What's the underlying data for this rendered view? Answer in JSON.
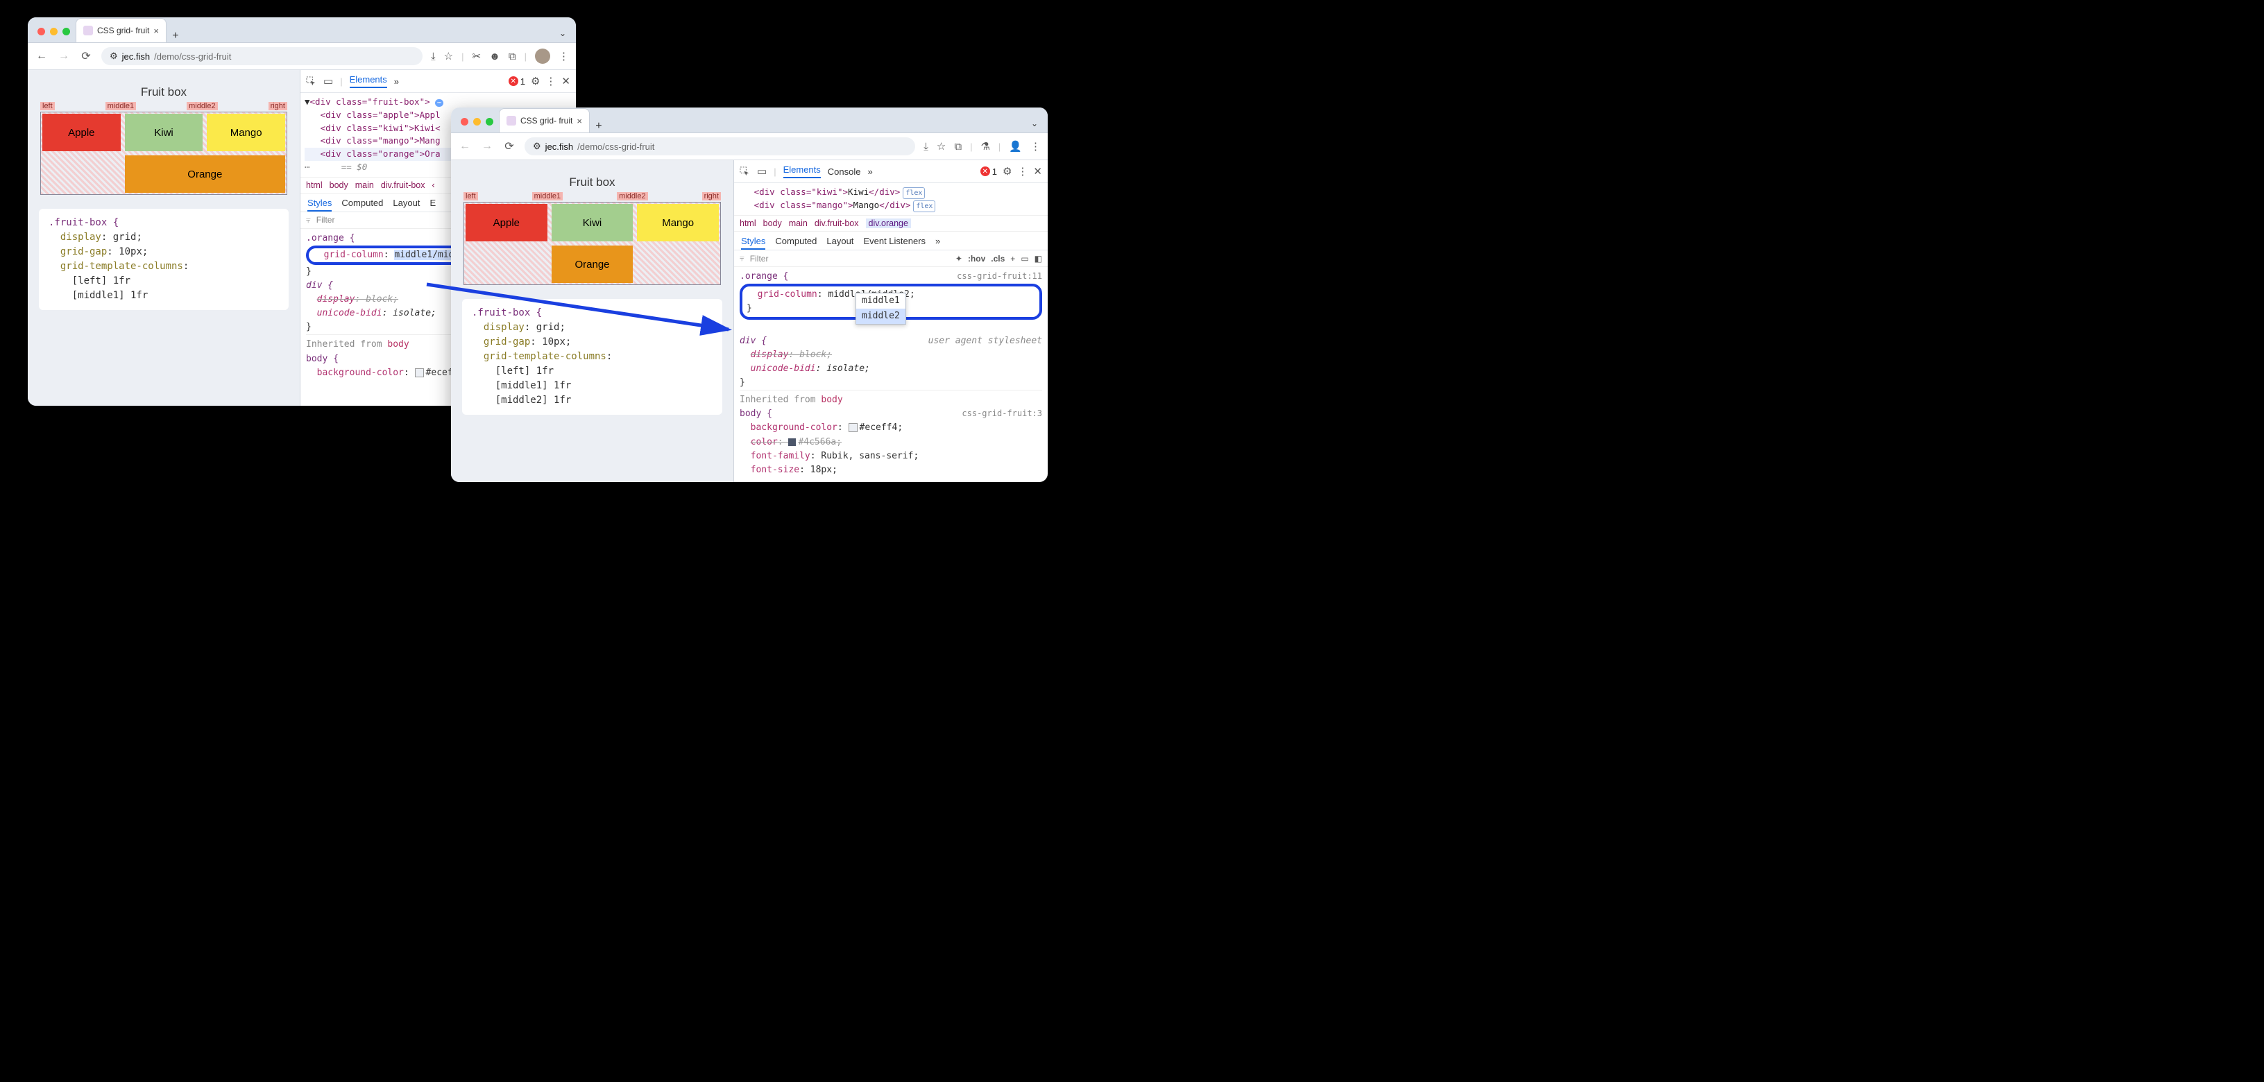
{
  "tab": {
    "title": "CSS grid- fruit"
  },
  "url": {
    "proto": "jec.fish",
    "path": "/demo/css-grid-fruit"
  },
  "page": {
    "title": "Fruit box",
    "labels": [
      "left",
      "middle1",
      "middle2",
      "right"
    ],
    "apple": "Apple",
    "kiwi": "Kiwi",
    "mango": "Mango",
    "orange": "Orange"
  },
  "css": {
    "selector": ".fruit-box {",
    "p1": "display",
    "v1": "grid",
    "p2": "grid-gap",
    "v2": "10px",
    "p3": "grid-template-columns",
    "l1": "[left] 1fr",
    "l2": "[middle1] 1fr",
    "l3": "[middle2] 1fr"
  },
  "dev": {
    "elements": "Elements",
    "console": "Console",
    "styles": "Styles",
    "computed": "Computed",
    "layout": "Layout",
    "events": "Event Listeners",
    "err": "1",
    "filter": "Filter",
    "hov": ":hov",
    "cls": ".cls"
  },
  "domL": {
    "open": "<div class=\"fruit-box\">",
    "apple": "<div class=\"apple\">Appl",
    "kiwi": "<div class=\"kiwi\">Kiwi<",
    "mango": "<div class=\"mango\">Mang",
    "orange": "<div class=\"orange\">Ora",
    "eq": "== $0"
  },
  "domR": {
    "kiwi_a": "<div class=\"kiwi\">",
    "kiwi_b": "Kiwi",
    "kiwi_c": "</div>",
    "mango_a": "<div class=\"mango\">",
    "mango_b": "Mango",
    "mango_c": "</div>",
    "flex": "flex"
  },
  "crumb": {
    "html": "html",
    "body": "body",
    "main": "main",
    "fb": "div.fruit-box",
    "or": "div.orange"
  },
  "styL": {
    "sel": ".orange {",
    "gcprop": "grid-column",
    "gcval": "middle1/mid",
    "divsel": "div {",
    "disp": "display",
    "dispv": "block",
    "uni": "unicode-bidi",
    "univ": "isolate",
    "inh": "Inherited from",
    "inhb": "body",
    "bodysel": "body {",
    "bgc": "background-color",
    "bgcv": "#eceff4",
    "ua": "us"
  },
  "styR": {
    "sel": ".orange {",
    "src": "css-grid-fruit:11",
    "gcprop": "grid-column",
    "gcval": "middle1/middle2",
    "divsel": "div {",
    "disp": "display",
    "dispv": "block",
    "uni": "unicode-bidi",
    "univ": "isolate",
    "ua": "user agent stylesheet",
    "inh": "Inherited from",
    "inhb": "body",
    "bodysel": "body {",
    "bsrc": "css-grid-fruit:3",
    "bgc": "background-color",
    "bgcv": "#eceff4",
    "col": "color",
    "colv": "#4c566a",
    "ff": "font-family",
    "ffv": "Rubik, sans-serif",
    "fs": "font-size",
    "fsv": "18px",
    "d1": "middle1",
    "d2": "middle2"
  }
}
